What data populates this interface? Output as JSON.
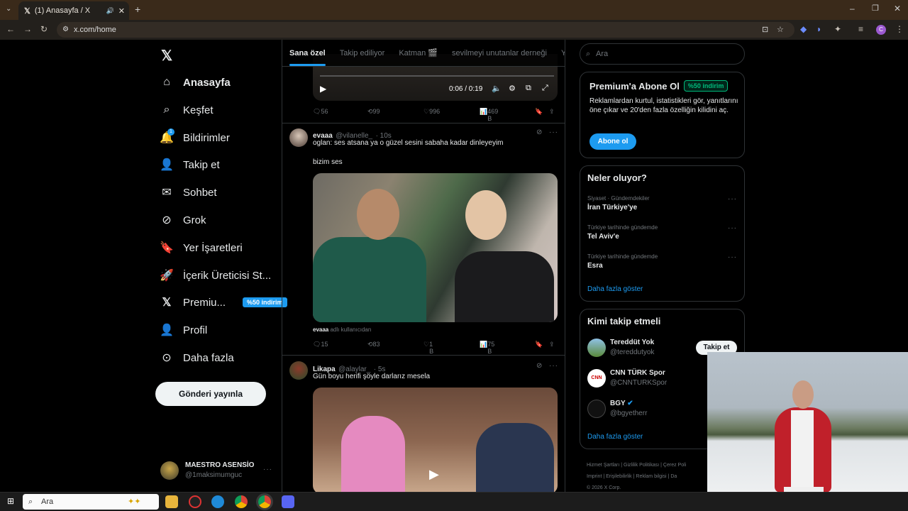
{
  "browser": {
    "tab_title": "(1) Anasayfa / X",
    "url": "x.com/home",
    "accent": "#1d9bf0"
  },
  "sidebar": {
    "items": [
      {
        "label": "Anasayfa",
        "icon": "home-icon"
      },
      {
        "label": "Keşfet",
        "icon": "search-icon"
      },
      {
        "label": "Bildirimler",
        "icon": "bell-icon",
        "badge": "1"
      },
      {
        "label": "Takip et",
        "icon": "follow-icon"
      },
      {
        "label": "Sohbet",
        "icon": "mail-icon"
      },
      {
        "label": "Grok",
        "icon": "grok-icon"
      },
      {
        "label": "Yer İşaretleri",
        "icon": "bookmark-icon"
      },
      {
        "label": "İçerik Üreticisi St...",
        "icon": "rocket-icon"
      },
      {
        "label": "Premiu...",
        "icon": "x-logo-icon",
        "badge": "%50 indirim"
      },
      {
        "label": "Profil",
        "icon": "person-icon"
      },
      {
        "label": "Daha fazla",
        "icon": "more-circle-icon"
      }
    ],
    "post_button": "Gönderi yayınla",
    "account": {
      "name": "MAESTRO ASENSİO",
      "handle": "@1maksimumguc"
    }
  },
  "feed_tabs": [
    "Sana özel",
    "Takip ediliyor",
    "Katman 🎬",
    "sevilmeyi unutanlar derneği",
    "Ya"
  ],
  "feed": {
    "video_time": "0:06 / 0:19",
    "first_actions": {
      "replies": "56",
      "reposts": "99",
      "likes": "996",
      "views": "469 B"
    },
    "tweets": [
      {
        "name": "evaaa",
        "handle": "@vilanelle_",
        "time": "· 10s",
        "text1": "oglan: ses atsana ya o güzel sesini sabaha kadar dinleyeyim",
        "text2": "bizim ses",
        "caption_name": "evaaa",
        "caption": "adlı kullanıcıdan",
        "actions": {
          "replies": "15",
          "reposts": "83",
          "likes": "1 B",
          "views": "75 B"
        }
      },
      {
        "name": "Likapa",
        "handle": "@alaylar_",
        "time": "· 5s",
        "text1": "Gün boyu herifi şöyle darlarız mesela"
      }
    ]
  },
  "right": {
    "search_placeholder": "Ara",
    "premium": {
      "title": "Premium'a Abone Ol",
      "badge": "%50 indirim",
      "desc": "Reklamlardan kurtul, istatistikleri gör, yanıtlarını öne çıkar ve 20'den fazla özelliğin kilidini aç.",
      "button": "Abone ol"
    },
    "trends": {
      "title": "Neler oluyor?",
      "items": [
        {
          "cat": "Siyaset · Gündemdekiler",
          "name": "İran Türkiye'ye"
        },
        {
          "cat": "Türkiye tarihinde gündemde",
          "name": "Tel Aviv'e"
        },
        {
          "cat": "Türkiye tarihinde gündemde",
          "name": "Esra"
        }
      ],
      "more": "Daha fazla göster"
    },
    "who_to_follow": {
      "title": "Kimi takip etmeli",
      "items": [
        {
          "name": "Tereddüt Yok",
          "handle": "@tereddutyok"
        },
        {
          "name": "CNN TÜRK Spor",
          "handle": "@CNNTURKSpor"
        },
        {
          "name": "BGY",
          "handle": "@bgyetherr"
        }
      ],
      "follow_label": "Takip et",
      "more": "Daha fazla göster"
    },
    "footer": {
      "links": [
        "Hizmet Şartları",
        "Gizlilik Politikası",
        "Çerez Poli",
        "Imprint",
        "Erişilebilirlik",
        "Reklam bilgisi",
        "Da"
      ],
      "copyright": "© 2026 X Corp."
    }
  },
  "taskbar": {
    "search_placeholder": "Ara"
  }
}
